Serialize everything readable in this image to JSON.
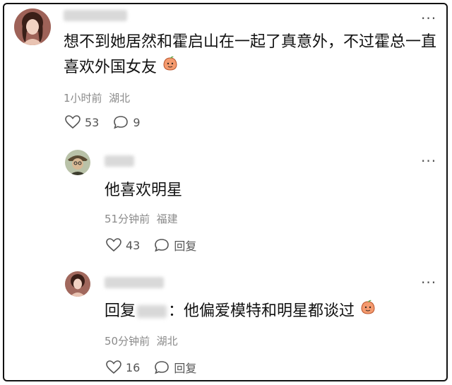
{
  "comments": [
    {
      "text_line1": "想不到她居然和霍启山在一起了真意外，不过霍总一直",
      "text_line2": "喜欢外国女友",
      "meta": "1小时前  湖北",
      "likes": "53",
      "replies": "9"
    },
    {
      "text": "他喜欢明星",
      "meta": "51分钟前  福建",
      "likes": "43",
      "reply_label": "回复"
    },
    {
      "reply_prefix": "回复",
      "text": "：他偏爱模特和明星都谈过",
      "meta": "50分钟前  湖北",
      "likes": "16",
      "reply_label": "回复"
    }
  ],
  "more_icon": "···",
  "icons": {
    "like": "heart-outline-icon",
    "comment": "speech-bubble-icon",
    "emoji": "peach-face-emoji"
  }
}
